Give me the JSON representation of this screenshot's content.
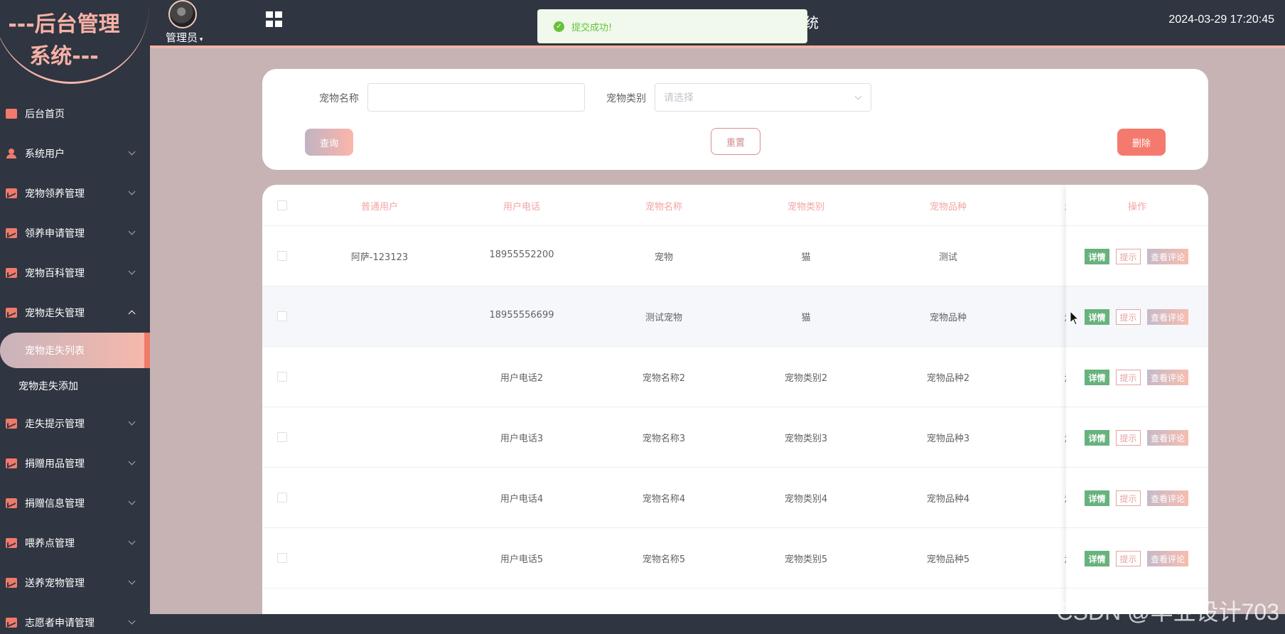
{
  "header": {
    "title_visible": "统",
    "admin_label": "管理员",
    "timestamp": "2024-03-29 17:20:45"
  },
  "toast": {
    "text": "提交成功!"
  },
  "logo": {
    "line1": "---后台管理",
    "line2": "系统---"
  },
  "sidebar": {
    "items": [
      {
        "label": "后台首页",
        "icon": "monitor-icon"
      },
      {
        "label": "系统用户",
        "icon": "user-icon"
      },
      {
        "label": "宠物领养管理",
        "icon": "chart-icon"
      },
      {
        "label": "领养申请管理",
        "icon": "chart-icon"
      },
      {
        "label": "宠物百科管理",
        "icon": "chart-icon"
      },
      {
        "label": "宠物走失管理",
        "icon": "chart-icon",
        "expanded": true
      },
      {
        "label": "走失提示管理",
        "icon": "chart-icon"
      },
      {
        "label": "捐赠用品管理",
        "icon": "chart-icon"
      },
      {
        "label": "捐赠信息管理",
        "icon": "chart-icon"
      },
      {
        "label": "喂养点管理",
        "icon": "chart-icon"
      },
      {
        "label": "送养宠物管理",
        "icon": "chart-icon"
      },
      {
        "label": "志愿者申请管理",
        "icon": "chart-icon"
      }
    ],
    "submenu": [
      {
        "label": "宠物走失列表",
        "active": true
      },
      {
        "label": "宠物走失添加",
        "active": false
      }
    ]
  },
  "search": {
    "pet_name_label": "宠物名称",
    "pet_name_value": "",
    "pet_type_label": "宠物类别",
    "pet_type_placeholder": "请选择",
    "query_button": "查询",
    "reset_button": "重置",
    "delete_button": "删除"
  },
  "table": {
    "columns": [
      "普通用户",
      "用户电话",
      "宠物名称",
      "宠物类别",
      "宠物品种",
      "走",
      "操作"
    ],
    "rows": [
      {
        "user": "阿萨-123123",
        "phone": "18955552200",
        "name": "宠物",
        "type": "猫",
        "breed": "测试",
        "extra": ""
      },
      {
        "user": "",
        "phone": "18955556699",
        "name": "测试宠物",
        "type": "猫",
        "breed": "宠物品种",
        "extra": "走"
      },
      {
        "user": "",
        "phone": "用户电话2",
        "name": "宠物名称2",
        "type": "宠物类别2",
        "breed": "宠物品种2",
        "extra": "走"
      },
      {
        "user": "",
        "phone": "用户电话3",
        "name": "宠物名称3",
        "type": "宠物类别3",
        "breed": "宠物品种3",
        "extra": "走"
      },
      {
        "user": "",
        "phone": "用户电话4",
        "name": "宠物名称4",
        "type": "宠物类别4",
        "breed": "宠物品种4",
        "extra": "走"
      },
      {
        "user": "",
        "phone": "用户电话5",
        "name": "宠物名称5",
        "type": "宠物类别5",
        "breed": "宠物品种5",
        "extra": "走"
      }
    ],
    "ops": {
      "detail": "详情",
      "tip": "提示",
      "comment": "查看评论"
    }
  },
  "watermark": "CSDN @毕业设计703",
  "colors": {
    "sidebar_bg": "#2f3541",
    "accent": "#f07a6c",
    "page_bg": "#c7b3b3",
    "success": "#67c23a"
  }
}
